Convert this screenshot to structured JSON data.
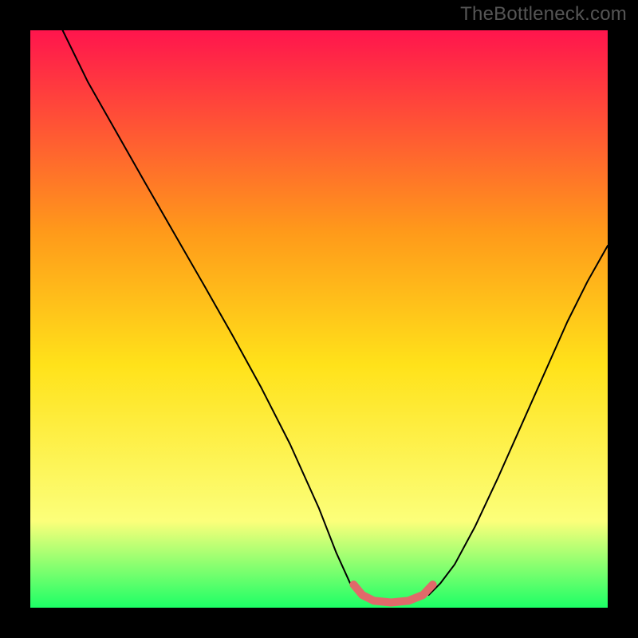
{
  "watermark": "TheBottleneck.com",
  "chart_data": {
    "type": "line",
    "title": "",
    "xlabel": "",
    "ylabel": "",
    "xlim": [
      0,
      1
    ],
    "ylim": [
      0,
      1
    ],
    "gradient_colors": {
      "top": "#ff154d",
      "mid_upper": "#ff9a1a",
      "mid": "#ffe21a",
      "low": "#fcff7a",
      "bottom": "#1cff66"
    },
    "series": [
      {
        "name": "left-curve",
        "stroke": "#000000",
        "x": [
          0.056,
          0.1,
          0.15,
          0.2,
          0.25,
          0.3,
          0.35,
          0.4,
          0.45,
          0.5,
          0.53,
          0.555,
          0.575
        ],
        "y": [
          1.0,
          0.91,
          0.822,
          0.734,
          0.647,
          0.56,
          0.472,
          0.381,
          0.283,
          0.172,
          0.095,
          0.04,
          0.022
        ]
      },
      {
        "name": "right-curve",
        "stroke": "#000000",
        "x": [
          0.69,
          0.71,
          0.735,
          0.77,
          0.81,
          0.85,
          0.89,
          0.93,
          0.965,
          1.0
        ],
        "y": [
          0.022,
          0.042,
          0.075,
          0.14,
          0.225,
          0.315,
          0.405,
          0.495,
          0.565,
          0.627
        ]
      },
      {
        "name": "valley-floor",
        "stroke": "#e06a6a",
        "stroke_width": 10,
        "x": [
          0.56,
          0.575,
          0.595,
          0.625,
          0.655,
          0.68,
          0.697
        ],
        "y": [
          0.04,
          0.022,
          0.012,
          0.009,
          0.012,
          0.022,
          0.04
        ]
      }
    ]
  }
}
